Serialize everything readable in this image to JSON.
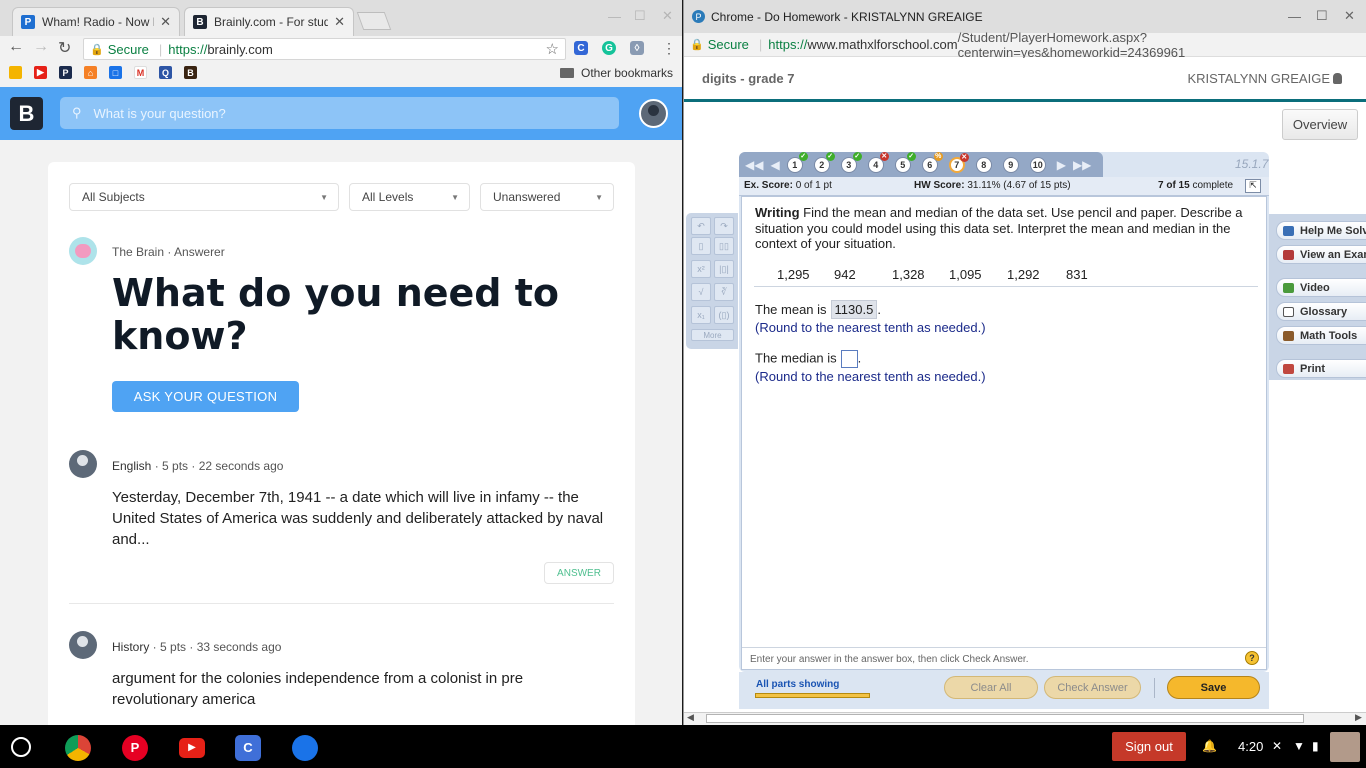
{
  "left_window": {
    "tabs": [
      {
        "title": "Wham! Radio - Now Pla",
        "favicon": "P"
      },
      {
        "title": "Brainly.com - For studen",
        "favicon": "B"
      }
    ],
    "address": {
      "secure_label": "Secure",
      "scheme": "https://",
      "host": "brainly.com"
    },
    "bookmarks": {
      "other_label": "Other bookmarks"
    },
    "brainly": {
      "search_placeholder": "What is your question?",
      "filters": [
        "All Subjects",
        "All Levels",
        "Unanswered"
      ],
      "answerer_name": "The Brain",
      "answerer_role": "Answerer",
      "headline": "What do you need to know?",
      "ask_button": "ASK YOUR QUESTION",
      "questions": [
        {
          "subject": "English",
          "points": "5 pts",
          "time": "22 seconds ago",
          "text": "Yesterday, December 7th, 1941 -- a date which will live in infamy -- the United States of America was suddenly and deliberately attacked by naval and...",
          "answer_label": "ANSWER"
        },
        {
          "subject": "History",
          "points": "5 pts",
          "time": "33 seconds ago",
          "text": "argument for the colonies independence from a colonist in pre revolutionary america"
        }
      ]
    }
  },
  "right_window": {
    "title": "Chrome - Do Homework - KRISTALYNN GREAIGE",
    "address": {
      "secure_label": "Secure",
      "scheme": "https://",
      "host": "www.mathxlforschool.com",
      "path": "/Student/PlayerHomework.aspx?centerwin=yes&homeworkid=24369961"
    },
    "course": "digits - grade 7",
    "student": "KRISTALYNN GREAIGE",
    "overview_button": "Overview",
    "nav": {
      "items": [
        {
          "n": "1",
          "status": "ok"
        },
        {
          "n": "2",
          "status": "ok"
        },
        {
          "n": "3",
          "status": "ok"
        },
        {
          "n": "4",
          "status": "no"
        },
        {
          "n": "5",
          "status": "ok"
        },
        {
          "n": "6",
          "status": "pr"
        },
        {
          "n": "7",
          "status": "no"
        },
        {
          "n": "8",
          "status": ""
        },
        {
          "n": "9",
          "status": ""
        },
        {
          "n": "10",
          "status": ""
        }
      ]
    },
    "section_id": "15.1.7",
    "scores": {
      "ex_label": "Ex. Score:",
      "ex_value": "0 of 1 pt",
      "hw_label": "HW Score:",
      "hw_value": "31.11% (4.67 of 15 pts)",
      "progress": "7 of 15",
      "progress_suffix": "complete"
    },
    "question": {
      "lead": "Writing",
      "text": "Find the mean and median of the data set. Use pencil and paper. Describe a situation you could model using this data set. Interpret the mean and median in the context of your situation.",
      "data": [
        "1,295",
        "942",
        "1,328",
        "1,095",
        "1,292",
        "831"
      ],
      "mean_label": "The mean is",
      "mean_value": "1130.5",
      "round_hint": "(Round to the nearest tenth as needed.)",
      "median_label": "The median is",
      "median_value": ""
    },
    "tools": [
      "Help Me Solve",
      "View an Example",
      "Video",
      "Glossary",
      "Math Tools",
      "Print"
    ],
    "footer_hint": "Enter your answer in the answer box, then click Check Answer.",
    "all_parts": "All parts showing",
    "buttons": {
      "clear": "Clear All",
      "check": "Check Answer",
      "save": "Save"
    }
  },
  "taskbar": {
    "sign_out": "Sign out",
    "time": "4:20"
  }
}
